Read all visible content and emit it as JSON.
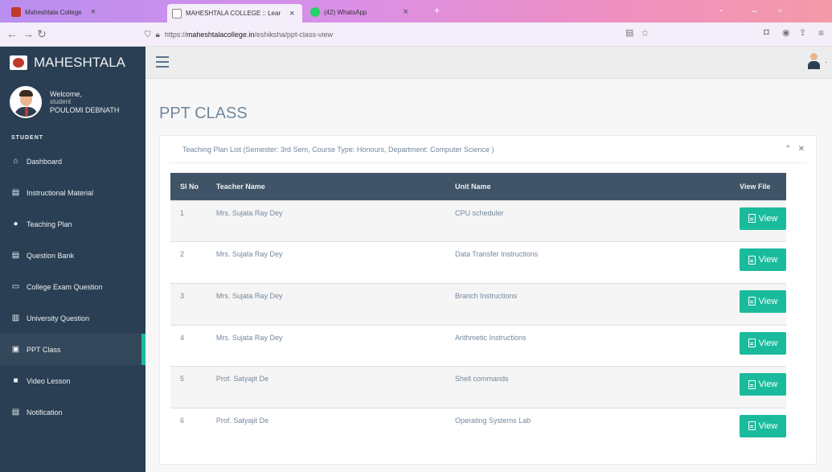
{
  "browser": {
    "tabs": [
      {
        "label": "Maheshtala College",
        "active": false
      },
      {
        "label": "MAHESHTALA COLLEGE :: Lear",
        "active": true
      },
      {
        "label": "(42) WhatsApp",
        "active": false
      }
    ],
    "new_tab_glyph": "+",
    "close_glyph": "×",
    "url_prefix": "https://",
    "url_host": "maheshtalacollege.in",
    "url_path": "/eshiksha/ppt-class-view"
  },
  "sidebar": {
    "brand": "MAHESHTALA",
    "welcome": "Welcome,",
    "role": "student",
    "user_name": "POULOMI DEBNATH",
    "section": "STUDENT",
    "items": [
      {
        "label": "Dashboard",
        "icon": "home-icon"
      },
      {
        "label": "Instructional Material",
        "icon": "file-icon"
      },
      {
        "label": "Teaching Plan",
        "icon": "user-icon"
      },
      {
        "label": "Question Bank",
        "icon": "file-icon"
      },
      {
        "label": "College Exam Question",
        "icon": "laptop-icon"
      },
      {
        "label": "University Question",
        "icon": "bank-icon"
      },
      {
        "label": "PPT Class",
        "icon": "image-file-icon",
        "active": true
      },
      {
        "label": "Video Lesson",
        "icon": "video-icon"
      },
      {
        "label": "Notification",
        "icon": "file-icon"
      }
    ]
  },
  "main": {
    "page_title": "PPT CLASS",
    "panel_title": "Teaching Plan List (Semester: 3rd Sem, Course Type: Honours, Department: Computer Science )",
    "table": {
      "headers": [
        "Sl No",
        "Teacher Name",
        "Unit Name",
        "View File"
      ],
      "rows": [
        {
          "sl": "1",
          "teacher": "Mrs. Sujata Ray Dey",
          "unit": "CPU scheduler"
        },
        {
          "sl": "2",
          "teacher": "Mrs. Sujata Ray Dey",
          "unit": "Data Transfer Instructions"
        },
        {
          "sl": "3",
          "teacher": "Mrs. Sujata Ray Dey",
          "unit": "Branch Instructions"
        },
        {
          "sl": "4",
          "teacher": "Mrs. Sujata Ray Dey",
          "unit": "Arithmetic Instructions"
        },
        {
          "sl": "5",
          "teacher": "Prof. Satyajit De",
          "unit": "Shell commands"
        },
        {
          "sl": "6",
          "teacher": "Prof. Satyajit De",
          "unit": "Operating Systems Lab"
        }
      ],
      "view_label": "View"
    }
  },
  "colors": {
    "sidebar_bg": "#2a3f54",
    "accent": "#1abb9c",
    "table_header": "#405467"
  }
}
